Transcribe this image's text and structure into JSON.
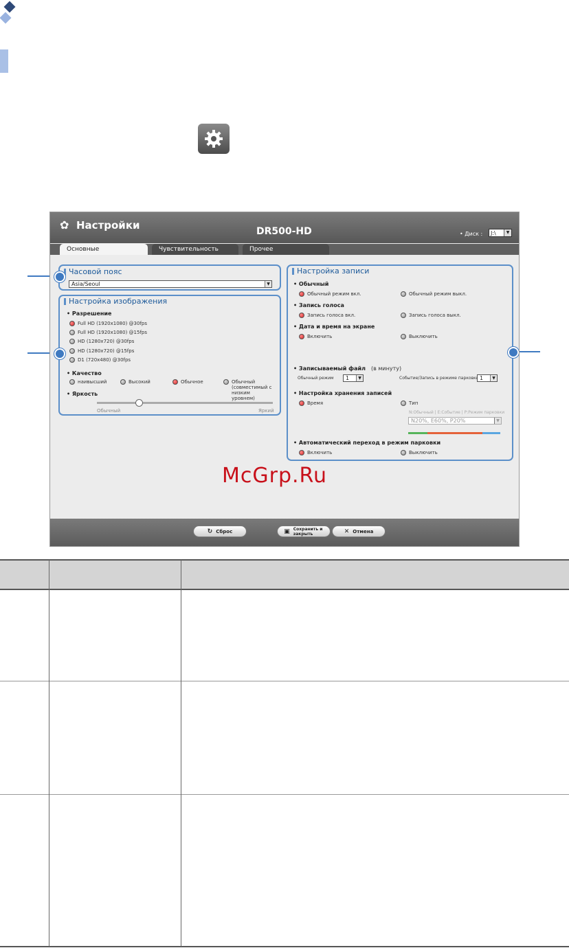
{
  "window": {
    "title": "Настройки",
    "model": "DR500-HD",
    "disk_label": "• Диск :",
    "disk_value": "J:\\"
  },
  "tabs": [
    {
      "label": "Основные",
      "active": true
    },
    {
      "label": "Чувствительность",
      "active": false
    },
    {
      "label": "Прочее",
      "active": false
    }
  ],
  "timezone": {
    "title": "Часовой пояс",
    "value": "Asia/Seoul"
  },
  "image_settings": {
    "title": "Настройка изображения",
    "resolution_label": "• Разрешение",
    "resolutions": [
      {
        "label": "Full HD (1920x1080) @30fps",
        "selected": true
      },
      {
        "label": "Full HD (1920x1080) @15fps",
        "selected": false
      },
      {
        "label": "HD (1280x720) @30fps",
        "selected": false
      },
      {
        "label": "HD (1280x720) @15fps",
        "selected": false
      },
      {
        "label": "D1 (720x480) @30fps",
        "selected": false
      }
    ],
    "quality_label": "• Качество",
    "qualities": [
      {
        "label": "наивысший",
        "selected": false
      },
      {
        "label": "Высокий",
        "selected": false
      },
      {
        "label": "Обычное",
        "selected": true
      },
      {
        "label": "Обычный (совместимый с низким уровнем)",
        "selected": false
      }
    ],
    "brightness_label": "• Яркость",
    "brightness_min": "Обычный",
    "brightness_max": "Яркий",
    "brightness_level": 0.24
  },
  "record_settings": {
    "title": "Настройка записи",
    "normal_label": "• Обычный",
    "normal_on": "Обычный режим вкл.",
    "normal_off": "Обычный режим выкл.",
    "voice_label": "• Запись голоса",
    "voice_on": "Запись голоса вкл.",
    "voice_off": "Запись голоса выкл.",
    "datetime_label": "• Дата и время на экране",
    "datetime_on": "Включить",
    "datetime_off": "Выключить",
    "file_label": "• Записываемый файл",
    "file_unit": "(в минуту)",
    "normal_mode_label": "Обычный режим",
    "normal_mode_value": "1",
    "event_parking_label": "Событие/Запись в режиме парковки",
    "event_parking_value": "1",
    "storage_label": "• Настройка хранения записей",
    "storage_time": "Время",
    "storage_type": "Тип",
    "storage_hint": "N:Обычный | E:Событие | P:Режим парковки",
    "storage_select": "N20%, E60%, P20%",
    "auto_parking_label": "• Автоматический переход в режим парковки",
    "auto_on": "Включить",
    "auto_off": "Выключить"
  },
  "buttons": {
    "reset": "Сброс",
    "save": "Сохранить и закрыть",
    "cancel": "Отмена"
  },
  "watermark": "McGrp.Ru",
  "colors": {
    "accent": "#5b8fc9",
    "selected_radio": "#d12020",
    "watermark": "#c8101a"
  }
}
